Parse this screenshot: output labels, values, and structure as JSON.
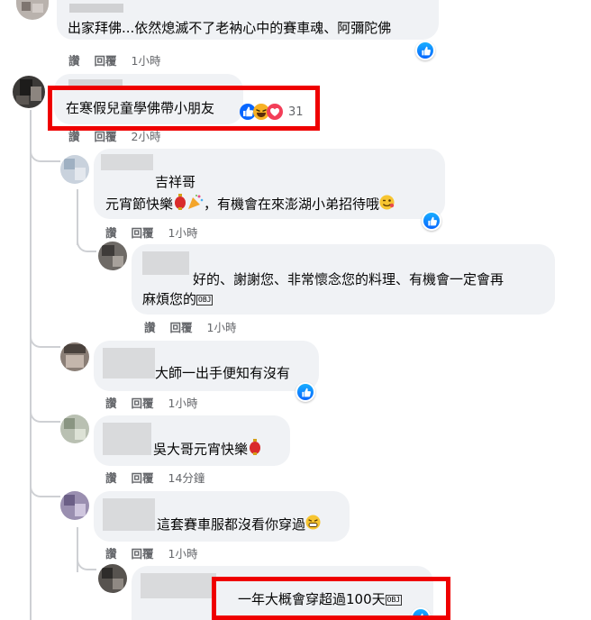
{
  "comments": [
    {
      "text": "出家拜佛...依然熄滅不了老衲心中的賽車魂、阿彌陀佛",
      "actions": [
        "讚",
        "回覆"
      ],
      "time": "1小時"
    },
    {
      "text": "在寒假兒童學佛帶小朋友",
      "reaction_count": "31",
      "actions": [
        "讚",
        "回覆"
      ],
      "time": "2小時"
    }
  ],
  "replies": [
    {
      "author": "吉祥哥",
      "text": "元宵節快樂",
      "text_suffix": "，有機會在來澎湖小弟招待哦",
      "actions": [
        "讚",
        "回覆"
      ],
      "time": "1小時"
    },
    {
      "text_line1": "好的、謝謝您、非常懷念您的料理、有機會一定會再",
      "text_line2": "麻煩您的",
      "obj": "OBJ",
      "actions": [
        "讚",
        "回覆"
      ],
      "time": "1小時"
    },
    {
      "text": "大師一出手便知有沒有",
      "actions": [
        "讚",
        "回覆"
      ],
      "time": "1小時"
    },
    {
      "text": "吳大哥元宵快樂",
      "actions": [
        "讚",
        "回覆"
      ],
      "time": "14分鐘"
    },
    {
      "text": "這套賽車服都沒看你穿過",
      "actions": [
        "讚",
        "回覆"
      ],
      "time": "1小時"
    },
    {
      "text": "一年大概會穿超過100天",
      "obj": "OBJ"
    }
  ],
  "icons": {
    "like": "like-icon",
    "haha": "haha-icon",
    "love": "heart-icon",
    "lantern": "lantern-emoji",
    "party": "party-popper-emoji",
    "wink": "wink-emoji",
    "grin": "grin-emoji"
  },
  "colors": {
    "highlight": "#ef0000",
    "bubble": "#f0f2f5",
    "meta": "#65676b",
    "like": "#0866ff"
  }
}
